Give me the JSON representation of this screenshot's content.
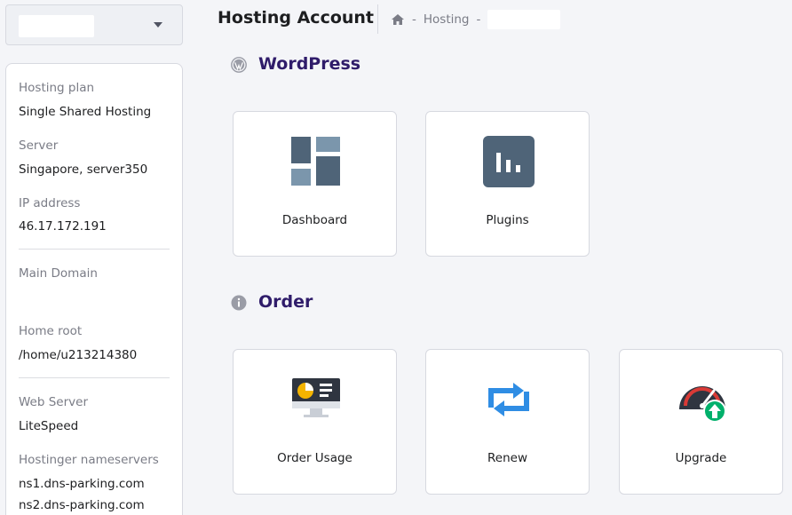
{
  "sidebar": {
    "account_select": {
      "value": ""
    },
    "details": [
      {
        "label": "Hosting plan",
        "value": "Single Shared Hosting"
      },
      {
        "label": "Server",
        "value": "Singapore, server350"
      },
      {
        "label": "IP address",
        "value": "46.17.172.191"
      },
      {
        "label": "Main Domain",
        "value": ""
      },
      {
        "label": "Home root",
        "value": "/home/u213214380"
      },
      {
        "label": "Web Server",
        "value": "LiteSpeed"
      },
      {
        "label": "Hostinger nameservers",
        "value": "ns1.dns-parking.com",
        "value2": "ns2.dns-parking.com"
      }
    ]
  },
  "header": {
    "title": "Hosting Account",
    "breadcrumb": {
      "home_icon": "home-icon",
      "sep": "-",
      "item1": "Hosting",
      "item2": ""
    }
  },
  "sections": {
    "wordpress": {
      "title": "WordPress",
      "icon": "wordpress-icon",
      "tiles": [
        {
          "label": "Dashboard",
          "icon": "dashboard-grid-icon"
        },
        {
          "label": "Plugins",
          "icon": "plugins-bars-icon"
        }
      ]
    },
    "order": {
      "title": "Order",
      "icon": "info-icon",
      "tiles": [
        {
          "label": "Order Usage",
          "icon": "monitor-pie-chart-icon"
        },
        {
          "label": "Renew",
          "icon": "renew-arrows-icon"
        },
        {
          "label": "Upgrade",
          "icon": "speedometer-upgrade-icon"
        }
      ]
    }
  },
  "colors": {
    "background": "#f4f5f8",
    "card": "#ffffff",
    "border": "#d7d9e0",
    "section_title": "#2f1c6a",
    "muted_text": "#7a7c86",
    "icon_slate": "#4f6478",
    "icon_blue": "#2f8de4",
    "upgrade_green": "#00b06b",
    "upgrade_red": "#d93a36",
    "order_usage_yellow": "#f4b400"
  }
}
